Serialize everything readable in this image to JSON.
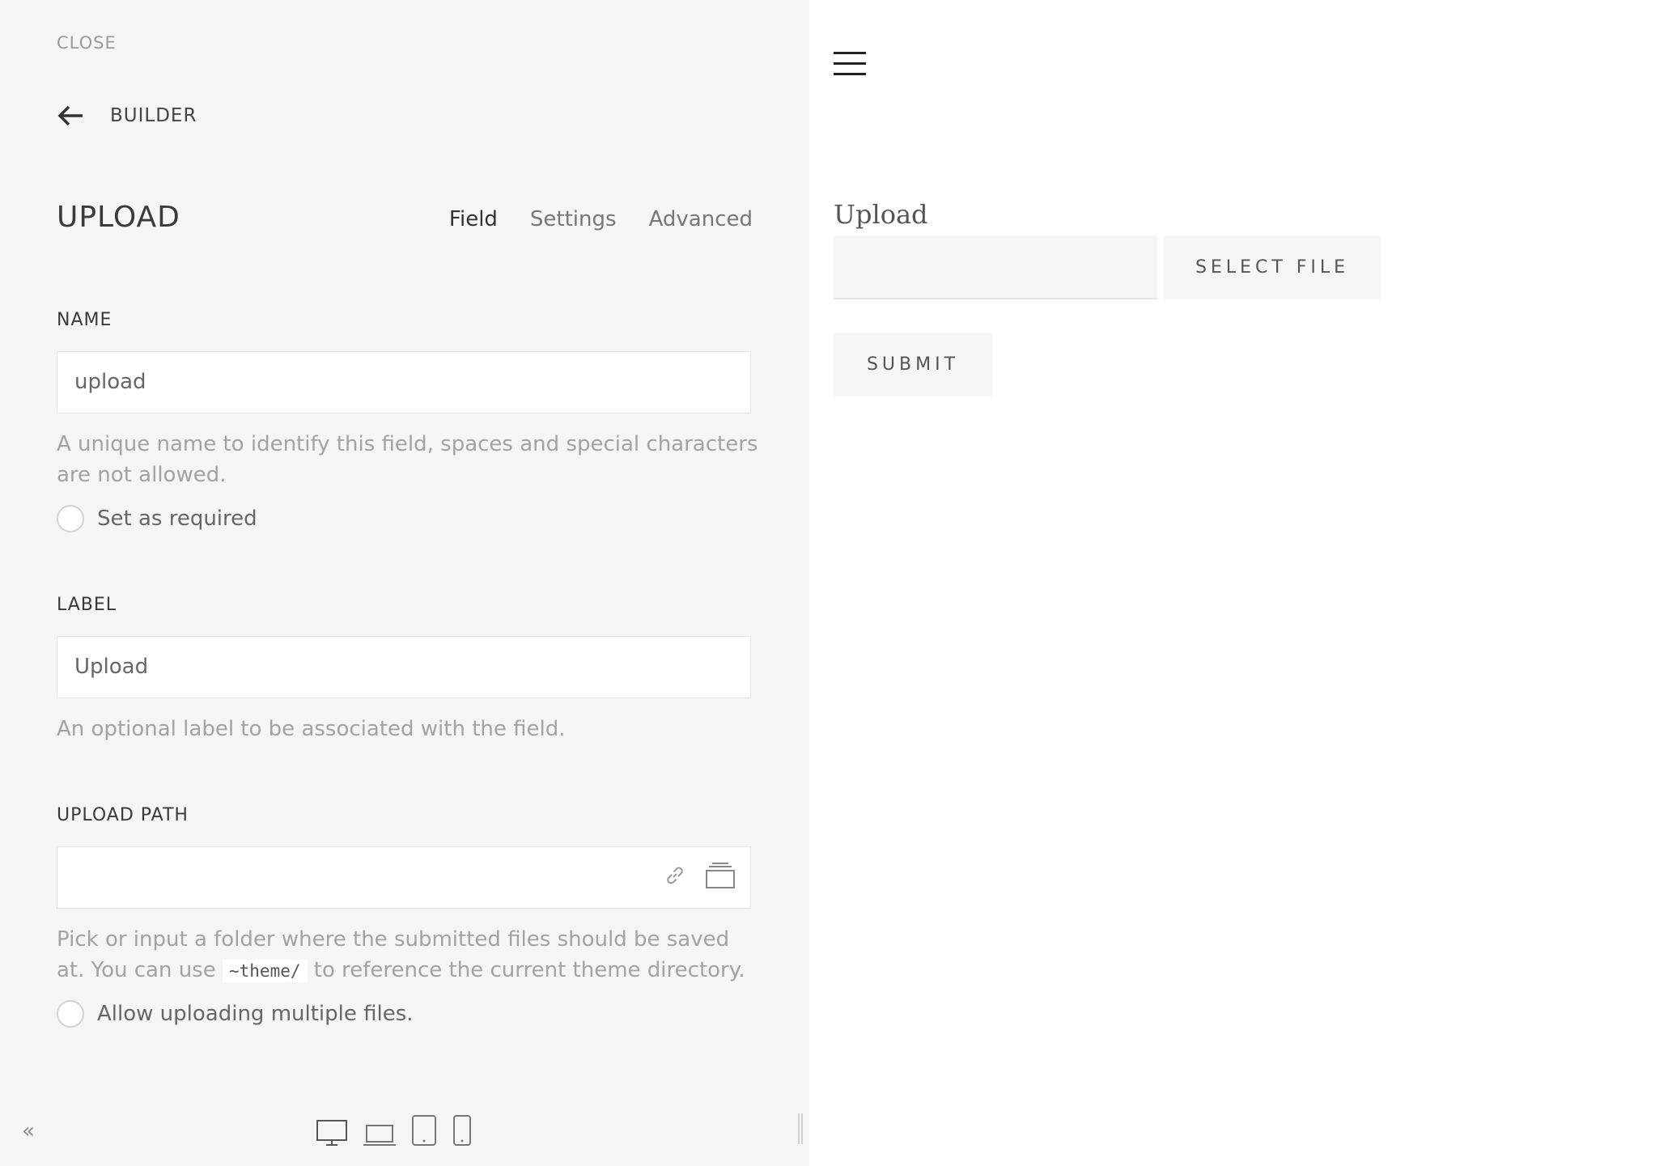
{
  "panel": {
    "close_label": "CLOSE",
    "back_label": "BUILDER",
    "title": "UPLOAD",
    "tabs": [
      {
        "label": "Field"
      },
      {
        "label": "Settings"
      },
      {
        "label": "Advanced"
      }
    ],
    "active_tab": "Field"
  },
  "fields": {
    "name": {
      "label": "NAME",
      "value": "upload",
      "help": "A unique name to identify this field, spaces and special characters are not allowed.",
      "required_label": "Set as required"
    },
    "label": {
      "label": "LABEL",
      "value": "Upload",
      "help": "An optional label to be associated with the field."
    },
    "upload_path": {
      "label": "UPLOAD PATH",
      "value": "",
      "help_before": "Pick or input a folder where the submitted files should be saved at. You can use",
      "help_code": "~theme/",
      "help_after": "to reference the current theme directory.",
      "multiple_label": "Allow uploading multiple files."
    }
  },
  "footer": {
    "collapse_icon": "«",
    "devices": [
      "desktop-icon",
      "laptop-icon",
      "tablet-icon",
      "phone-icon"
    ]
  },
  "preview": {
    "field_label": "Upload",
    "select_file_label": "SELECT FILE",
    "submit_label": "SUBMIT"
  }
}
